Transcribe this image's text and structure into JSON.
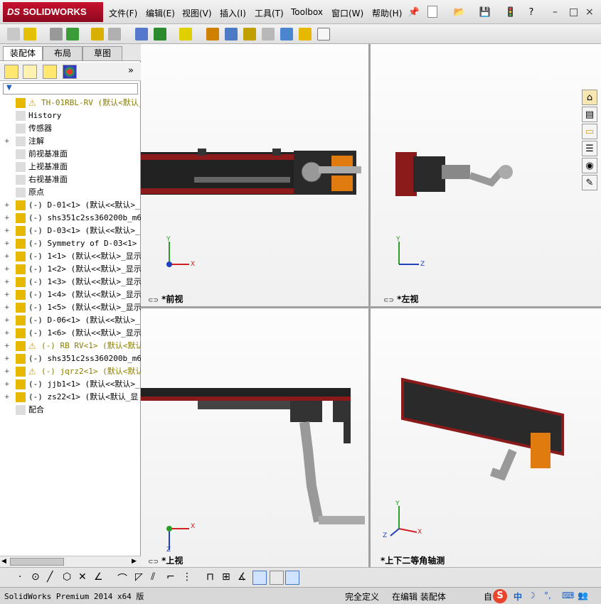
{
  "app": {
    "logo_text": "SOLIDWORKS",
    "logo_prefix": "DS",
    "menu": [
      "文件(F)",
      "编辑(E)",
      "视图(V)",
      "插入(I)",
      "工具(T)",
      "Toolbox",
      "窗口(W)",
      "帮助(H)"
    ],
    "window_buttons": [
      "–",
      "□",
      "×"
    ],
    "help_glyph": "?"
  },
  "panel": {
    "tabs": [
      "装配体",
      "布局",
      "草图"
    ],
    "expand_glyph": "»",
    "filter_glyph": "▼",
    "tree": [
      {
        "label": "TH-01RBL-RV  (默认<默认_显",
        "warn": true,
        "expander": ""
      },
      {
        "label": "History",
        "expander": ""
      },
      {
        "label": "传感器",
        "expander": ""
      },
      {
        "label": "注解",
        "expander": "+"
      },
      {
        "label": "前视基准面",
        "expander": ""
      },
      {
        "label": "上视基准面",
        "expander": ""
      },
      {
        "label": "右视基准面",
        "expander": ""
      },
      {
        "label": "原点",
        "expander": ""
      },
      {
        "label": "(-) D-01<1> (默认<<默认>_",
        "expander": "+"
      },
      {
        "label": "(-) shs351c2ss360200b_m6f(",
        "expander": "+"
      },
      {
        "label": "(-) D-03<1> (默认<<默认>_",
        "expander": "+"
      },
      {
        "label": "(-) Symmetry of D-03<1> (",
        "expander": "+"
      },
      {
        "label": "(-) 1<1> (默认<<默认>_显示",
        "expander": "+"
      },
      {
        "label": "(-) 1<2> (默认<<默认>_显示",
        "expander": "+"
      },
      {
        "label": "(-) 1<3> (默认<<默认>_显示",
        "expander": "+"
      },
      {
        "label": "(-) 1<4> (默认<<默认>_显示",
        "expander": "+"
      },
      {
        "label": "(-) 1<5> (默认<<默认>_显示",
        "expander": "+"
      },
      {
        "label": "(-) D-06<1> (默认<<默认>_",
        "expander": "+"
      },
      {
        "label": "(-) 1<6> (默认<<默认>_显示",
        "expander": "+"
      },
      {
        "label": "(-) RB RV<1> (默认<默认",
        "warn": true,
        "expander": "+"
      },
      {
        "label": "(-) shs351c2ss360200b_m6f(",
        "expander": "+"
      },
      {
        "label": "(-) jqrz2<1> (默认<默认",
        "warn": true,
        "expander": "+"
      },
      {
        "label": "(-) jjb1<1> (默认<<默认>_",
        "expander": "+"
      },
      {
        "label": "(-) zs22<1> (默认<默认_显",
        "expander": "+"
      },
      {
        "label": "配合",
        "expander": ""
      }
    ]
  },
  "views": {
    "front": "*前视",
    "left": "*左视",
    "top": "*上视",
    "iso": "*上下二等角轴测"
  },
  "axes": {
    "x": "X",
    "y": "Y",
    "z": "Z"
  },
  "status": {
    "version": "SolidWorks Premium 2014 x64 版",
    "defined": "完全定义",
    "editing": "在编辑 装配体",
    "custom": "自",
    "ime_lang": "中"
  }
}
